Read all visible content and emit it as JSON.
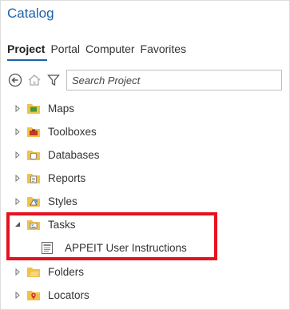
{
  "pane": {
    "title": "Catalog"
  },
  "tabs": [
    {
      "label": "Project",
      "active": true
    },
    {
      "label": "Portal",
      "active": false
    },
    {
      "label": "Computer",
      "active": false
    },
    {
      "label": "Favorites",
      "active": false
    }
  ],
  "toolbar": {
    "back_icon": "back-arrow-icon",
    "home_icon": "home-icon",
    "filter_icon": "filter-icon",
    "search_placeholder": "Search Project"
  },
  "tree": {
    "items": [
      {
        "label": "Maps",
        "icon": "maps-folder-icon",
        "expanded": false
      },
      {
        "label": "Toolboxes",
        "icon": "toolboxes-folder-icon",
        "expanded": false
      },
      {
        "label": "Databases",
        "icon": "databases-folder-icon",
        "expanded": false
      },
      {
        "label": "Reports",
        "icon": "reports-folder-icon",
        "expanded": false
      },
      {
        "label": "Styles",
        "icon": "styles-folder-icon",
        "expanded": false
      },
      {
        "label": "Tasks",
        "icon": "tasks-folder-icon",
        "expanded": true
      },
      {
        "label": "APPEIT User Instructions",
        "icon": "task-document-icon",
        "child": true
      },
      {
        "label": "Folders",
        "icon": "folders-folder-icon",
        "expanded": false
      },
      {
        "label": "Locators",
        "icon": "locators-folder-icon",
        "expanded": false
      }
    ]
  },
  "colors": {
    "accent": "#1a64a8",
    "folder": "#f0c24a",
    "highlight": "#e8111e"
  }
}
